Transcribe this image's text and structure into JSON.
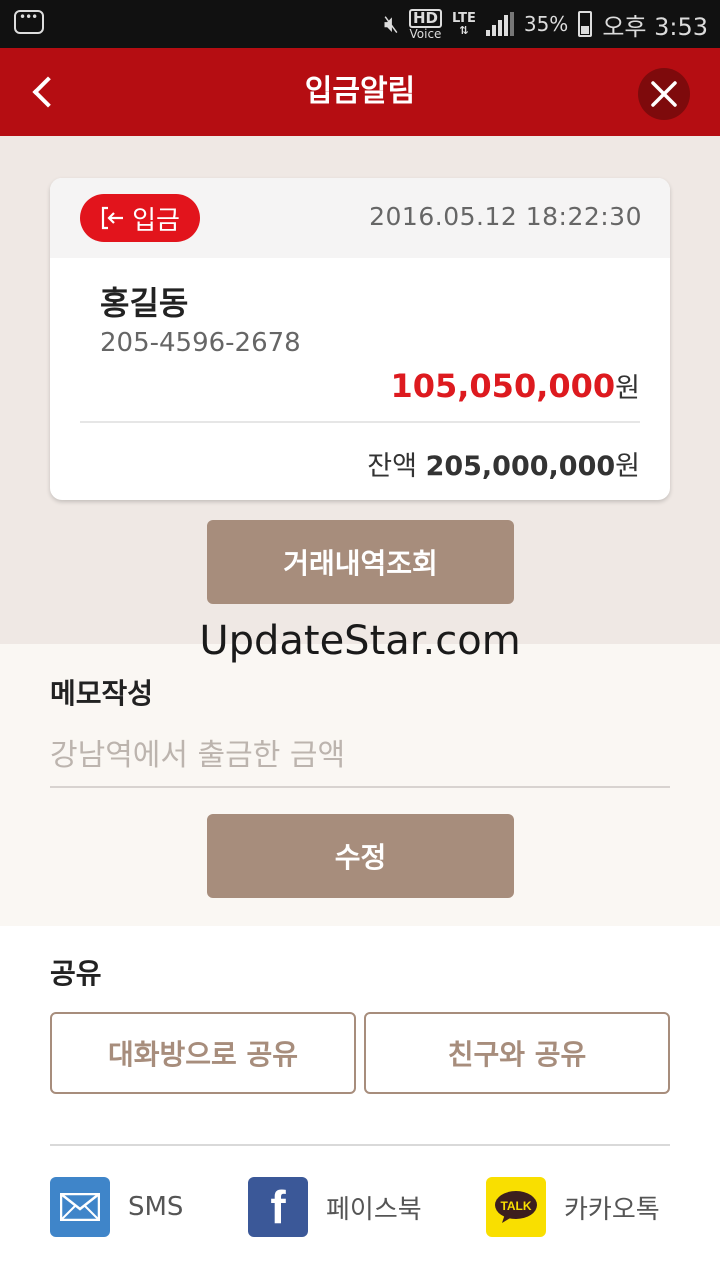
{
  "status_bar": {
    "hd": "HD",
    "voice": "Voice",
    "network": "LTE",
    "battery": "35%",
    "time": "오후 3:53"
  },
  "header": {
    "title": "입금알림"
  },
  "notification": {
    "badge_label": "입금",
    "datetime": "2016.05.12  18:22:30",
    "name": "홍길동",
    "account": "205-4596-2678",
    "amount": "105,050,000",
    "currency": "원",
    "balance_label": "잔액",
    "balance": "205,000,000"
  },
  "history_button": "거래내역조회",
  "watermark": "UpdateStar.com",
  "memo": {
    "title": "메모작성",
    "placeholder": "강남역에서 출금한 금액",
    "edit_button": "수정"
  },
  "share": {
    "title": "공유",
    "chat_button": "대화방으로 공유",
    "friend_button": "친구와 공유",
    "items": [
      {
        "label": "SMS",
        "icon": "mail-icon"
      },
      {
        "label": "페이스북",
        "icon": "facebook-icon"
      },
      {
        "label": "카카오톡",
        "icon": "kakaotalk-icon",
        "icon_text": "TALK"
      }
    ]
  },
  "colors": {
    "header": "#b50d12",
    "badge": "#e2141c",
    "amount": "#dd1a1f",
    "button": "#a78d7c",
    "top_bg": "#efe8e4"
  }
}
